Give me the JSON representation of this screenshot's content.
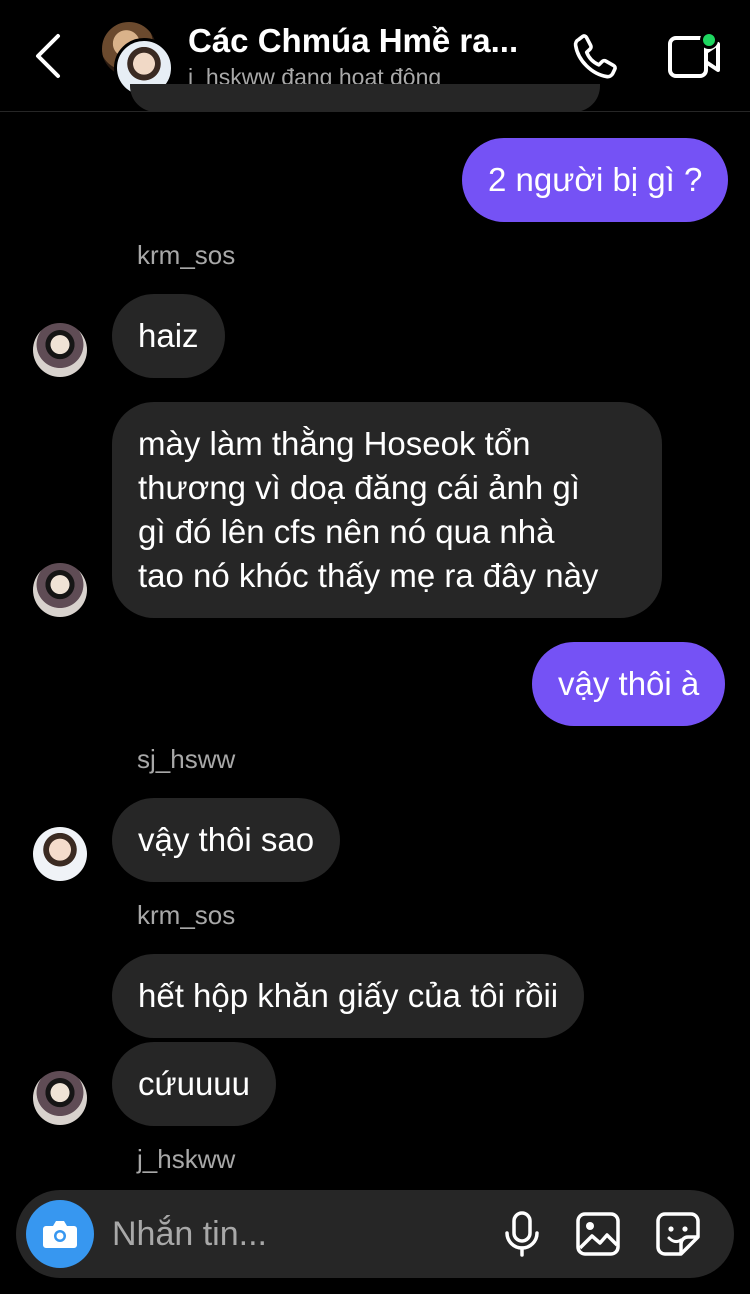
{
  "header": {
    "title": "Các Chmúa Hmề ra...",
    "status": "j_hskww đang hoạt động",
    "icons": [
      "chevron-left-icon",
      "phone-icon",
      "video-call-icon"
    ]
  },
  "messages": [
    {
      "from": "me",
      "text": "2 người bị gì ?"
    },
    {
      "sender": "krm_sos"
    },
    {
      "from": "krm_sos",
      "text": "haiz"
    },
    {
      "from": "krm_sos",
      "lines": [
        "mày làm thằng Hoseok tổn",
        "thương vì doạ đăng cái ảnh gì",
        "gì đó lên cfs nên nó qua nhà",
        "tao nó khóc thấy mẹ ra đây này"
      ]
    },
    {
      "from": "me",
      "text": "vậy thôi à"
    },
    {
      "sender": "sj_hsww"
    },
    {
      "from": "sj_hsww",
      "text": "vậy thôi sao"
    },
    {
      "sender": "krm_sos"
    },
    {
      "from": "krm_sos",
      "text": "hết hộp khăn giấy của tôi rồii"
    },
    {
      "from": "krm_sos",
      "text": "cứuuuu"
    },
    {
      "sender": "j_hskww"
    }
  ],
  "composer": {
    "placeholder": "Nhắn tin...",
    "icons": [
      "camera-icon",
      "microphone-icon",
      "gallery-icon",
      "sticker-icon"
    ],
    "accent": "#3797f0"
  },
  "colors": {
    "my_bubble": "#7552f5",
    "their_bubble": "#262626",
    "online": "#1ed760"
  }
}
